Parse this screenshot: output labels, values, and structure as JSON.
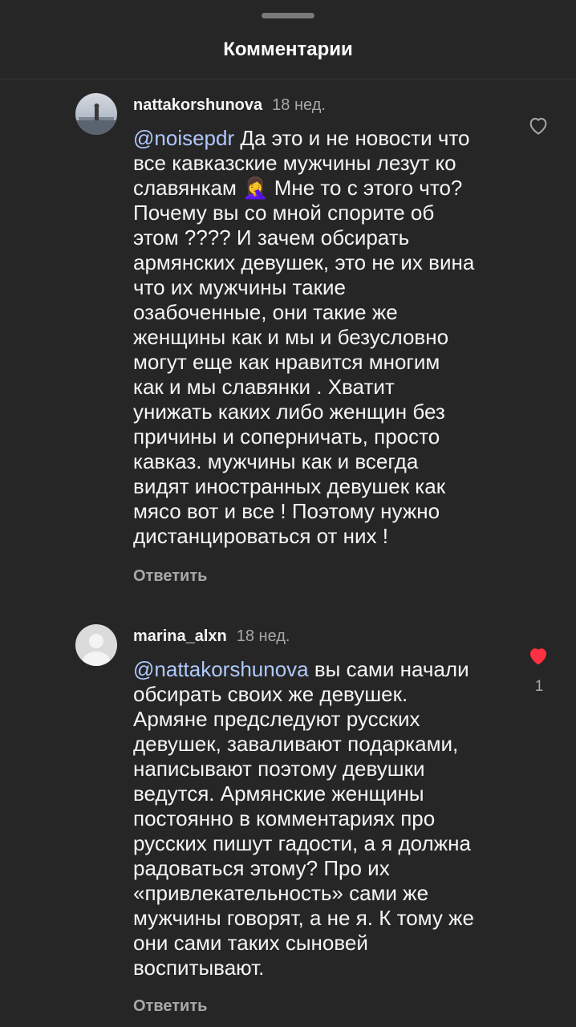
{
  "header": {
    "title": "Комментарии"
  },
  "comments": [
    {
      "username": "nattakorshunova",
      "time": "18 нед.",
      "mention": "@noisepdr",
      "text": " Да это и не новости что\nвсе кавказские мужчины лезут ко\nславянкам 🤦‍♀️ Мне то с этого что?\nПочему вы со мной спорите об\nэтом ???? И зачем обсирать\nармянских девушек, это не их вина\nчто их мужчины такие\nозабоченные, они такие же\nженщины как и мы и безусловно\nмогут еще как нравится многим\nкак и мы славянки . Хватит\nунижать каких либо женщин без\nпричины и соперничать, просто\nкавказ. мужчины как и всегда\nвидят иностранных девушек как\nмясо вот и все ! Поэтому нужно\nдистанцироваться от них !",
      "reply_label": "Ответить",
      "liked": false,
      "like_count": ""
    },
    {
      "username": "marina_alxn",
      "time": "18 нед.",
      "mention": "@nattakorshunova",
      "text": " вы сами начали\nобсирать своих же девушек.\nАрмяне предследуют русских\nдевушек, заваливают подарками,\nнаписывают поэтому девушки\nведутся. Армянские женщины\nпостоянно в комментариях про\nрусских пишут гадости, а я должна\nрадоваться этому? Про их\n«привлекательность» сами же\nмужчины говорят, а не я. К тому же\nони сами таких сыновей\nвоспитывают.",
      "reply_label": "Ответить",
      "liked": true,
      "like_count": "1"
    }
  ],
  "colors": {
    "background": "#262626",
    "like_red": "#ff3040",
    "muted": "#a8a8a8"
  }
}
